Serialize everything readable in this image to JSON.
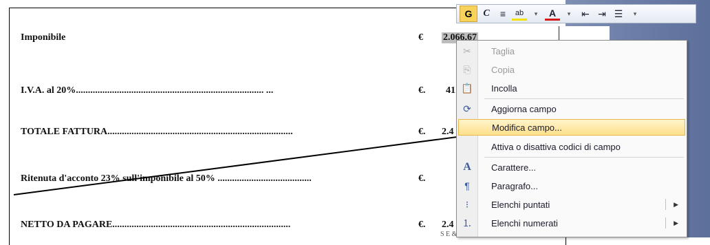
{
  "document": {
    "rows": [
      {
        "label": "Imponibile",
        "currency": "€",
        "value": "2.066,67"
      },
      {
        "label": "I.V.A. al 20%.............................................................................. ...",
        "currency": "€.",
        "value": "41"
      },
      {
        "label": "TOTALE FATTURA.............................................................................",
        "currency": "€.",
        "value": "2.4"
      },
      {
        "label": "Ritenuta d'acconto 23% sull'imponibile al 50% .......................................",
        "currency": "€.",
        "value": ""
      },
      {
        "label": "NETTO DA PAGARE..........................................................................",
        "currency": "€.",
        "value": "2.4"
      }
    ],
    "bottom_fragment": "S E & O"
  },
  "toolbar": {
    "bold": "G",
    "italic": "C",
    "align": "≡",
    "highlight": "ab",
    "font_color": "A",
    "indent_decrease": "⇤",
    "indent_increase": "⇥",
    "bullets": "☰"
  },
  "context_menu": {
    "items": [
      {
        "label": "Taglia",
        "icon": "scissors-icon",
        "glyph": "✂",
        "enabled": false
      },
      {
        "label": "Copia",
        "icon": "copy-icon",
        "glyph": "⎘",
        "enabled": false
      },
      {
        "label": "Incolla",
        "icon": "paste-icon",
        "glyph": "📋",
        "enabled": true
      },
      {
        "label": "Aggiorna campo",
        "icon": "update-field-icon",
        "glyph": "⟳",
        "enabled": true
      },
      {
        "label": "Modifica campo...",
        "icon": "",
        "glyph": "",
        "enabled": true,
        "highlighted": true
      },
      {
        "label": "Attiva o disattiva codici di campo",
        "icon": "",
        "glyph": "",
        "enabled": true
      },
      {
        "label": "Carattere...",
        "icon": "font-icon",
        "glyph": "A",
        "enabled": true
      },
      {
        "label": "Paragrafo...",
        "icon": "paragraph-icon",
        "glyph": "¶",
        "enabled": true
      },
      {
        "label": "Elenchi puntati",
        "icon": "bullets-icon",
        "glyph": "⁝",
        "enabled": true,
        "submenu": true
      },
      {
        "label": "Elenchi numerati",
        "icon": "numbering-icon",
        "glyph": "⒈",
        "enabled": true,
        "submenu": true
      }
    ],
    "submenu_arrow": "▶"
  },
  "colors": {
    "highlight_item": "#ffe08a",
    "bold_button": "#f7d35c",
    "app_background": "#6d7fa8"
  }
}
